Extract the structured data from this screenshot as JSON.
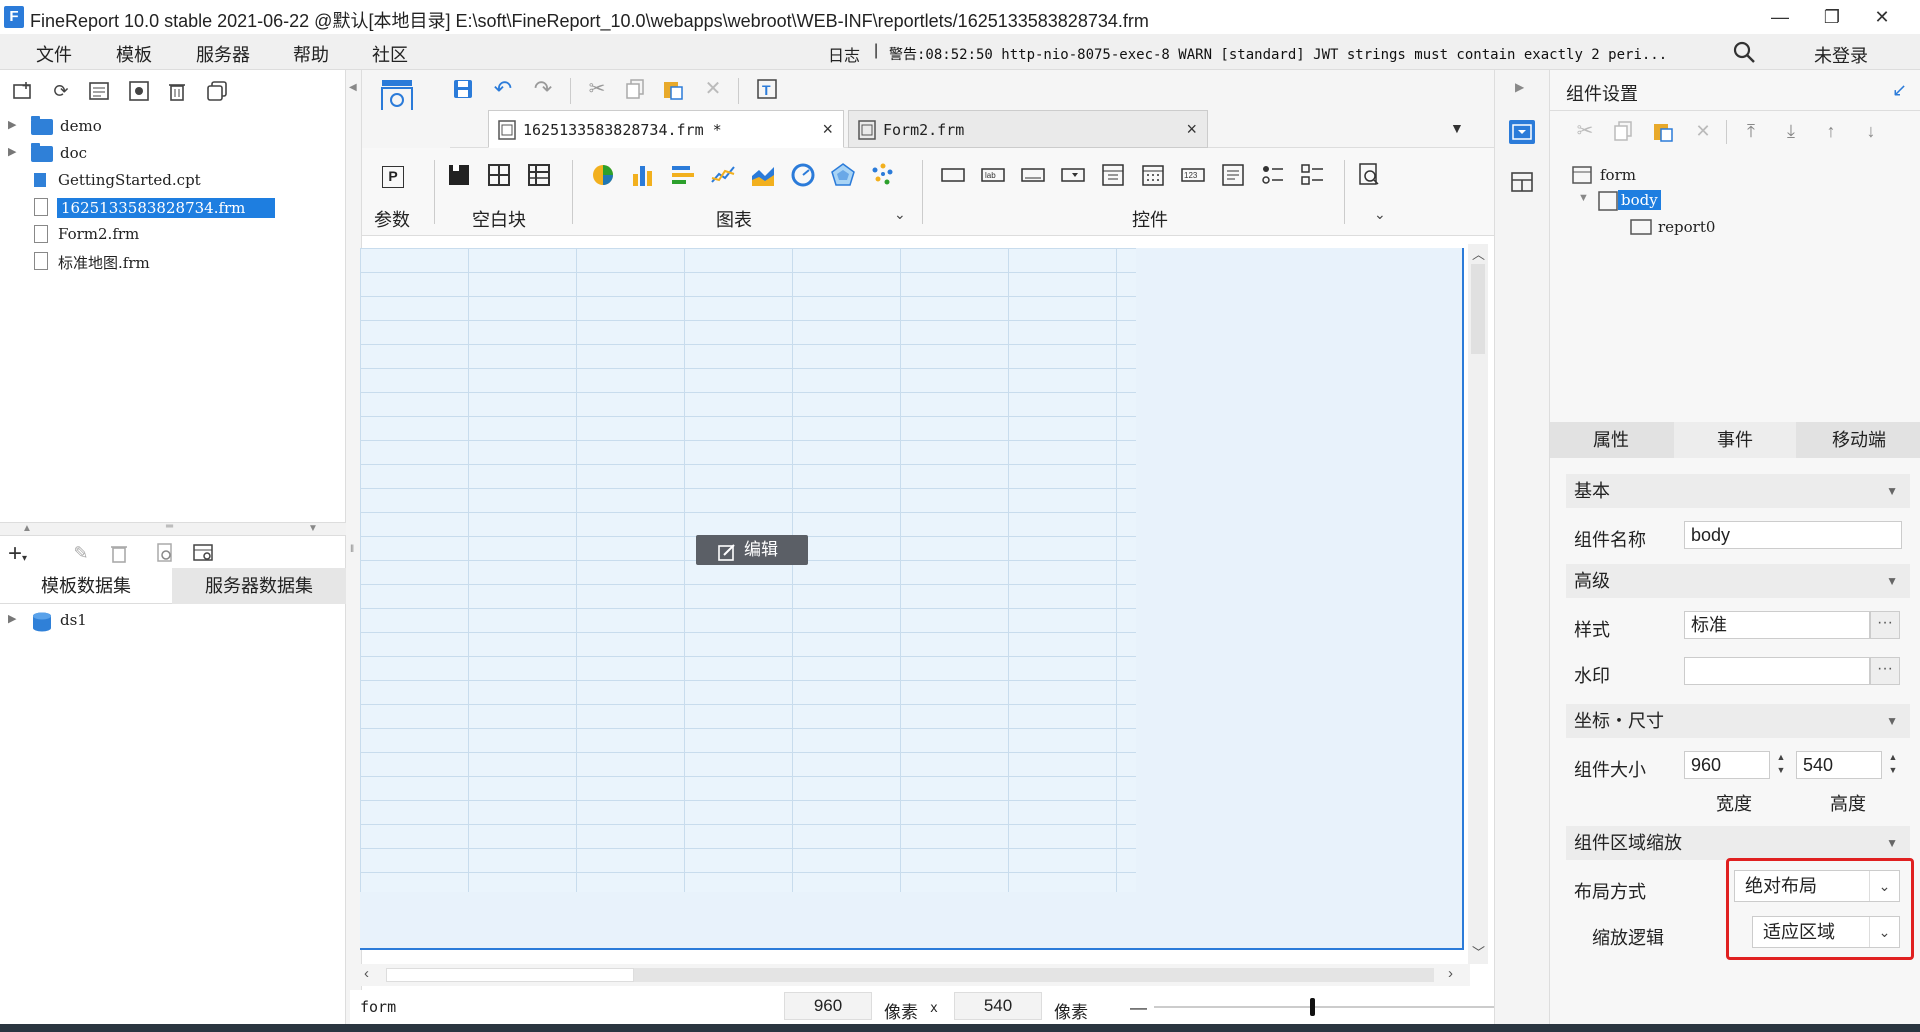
{
  "window": {
    "title": "FineReport 10.0 stable 2021-06-22 @默认[本地目录]   E:\\soft\\FineReport_10.0\\webapps\\webroot\\WEB-INF\\reportlets/1625133583828734.frm",
    "logo_letter": "F"
  },
  "menu": {
    "items": [
      "文件",
      "模板",
      "服务器",
      "帮助",
      "社区"
    ],
    "log_label": "日志",
    "log_sep": "|",
    "log_message": "警告:08:52:50 http-nio-8075-exec-8 WARN [standard] JWT strings must contain exactly 2 peri...",
    "login": "未登录"
  },
  "tree": {
    "items": [
      {
        "label": "demo",
        "type": "folder"
      },
      {
        "label": "doc",
        "type": "folder"
      },
      {
        "label": "GettingStarted.cpt",
        "type": "cpt"
      },
      {
        "label": "1625133583828734.frm",
        "type": "frm",
        "selected": true
      },
      {
        "label": "Form2.frm",
        "type": "frm"
      },
      {
        "label": "标准地图.frm",
        "type": "frm"
      }
    ]
  },
  "datasets": {
    "tabs": [
      "模板数据集",
      "服务器数据集"
    ],
    "items": [
      "ds1"
    ]
  },
  "editor": {
    "tabs": [
      {
        "label": "1625133583828734.frm *",
        "close": "×"
      },
      {
        "label": "Form2.frm",
        "close": "×"
      }
    ],
    "groups": [
      "参数",
      "空白块",
      "图表",
      "控件"
    ],
    "param_icon": "P",
    "edit_button": "编辑"
  },
  "status": {
    "form": "form",
    "width": "960",
    "unit1": "像素",
    "times": "x",
    "height": "540",
    "unit2": "像素",
    "minus": "—"
  },
  "right": {
    "title": "组件设置",
    "tree": [
      "form",
      "body",
      "report0"
    ],
    "tabs": [
      "属性",
      "事件",
      "移动端"
    ],
    "sections": {
      "basic": "基本",
      "advanced": "高级",
      "coords": "坐标・尺寸",
      "scale": "组件区域缩放"
    },
    "fields": {
      "name_label": "组件名称",
      "name_value": "body",
      "style_label": "样式",
      "style_value": "标准",
      "watermark_label": "水印",
      "watermark_value": "",
      "size_label": "组件大小",
      "width": "960",
      "height": "540",
      "width_label": "宽度",
      "height_label": "高度",
      "layout_label": "布局方式",
      "layout_value": "绝对布局",
      "scale_label": "缩放逻辑",
      "scale_value": "适应区域",
      "dots": "···"
    }
  },
  "colors": {
    "accent": "#1e7ee0",
    "highlight": "#e02020"
  }
}
